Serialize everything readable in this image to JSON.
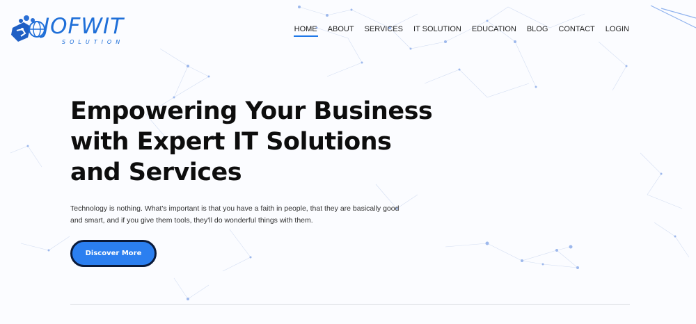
{
  "brand": {
    "name": "JOFWIT",
    "subtitle": "SOLUTION",
    "color": "#1f6fd8"
  },
  "nav": {
    "items": [
      {
        "label": "HOME",
        "active": true
      },
      {
        "label": "ABOUT",
        "active": false
      },
      {
        "label": "SERVICES",
        "active": false
      },
      {
        "label": "IT SOLUTION",
        "active": false
      },
      {
        "label": "EDUCATION",
        "active": false
      },
      {
        "label": "BLOG",
        "active": false
      },
      {
        "label": "CONTACT",
        "active": false
      },
      {
        "label": "LOGIN",
        "active": false
      }
    ],
    "active_color": "#1f78e8"
  },
  "hero": {
    "title_line1": "Empowering Your Business",
    "title_line2": "with Expert IT Solutions",
    "title_line3": "and Services",
    "description_line1": "Technology is nothing. What's important is that you have a faith in people, that they are basically good",
    "description_line2": "and smart, and if you give them tools, they'll do wonderful things with them.",
    "cta_label": "Discover More",
    "cta_color": "#2b7ff0"
  }
}
